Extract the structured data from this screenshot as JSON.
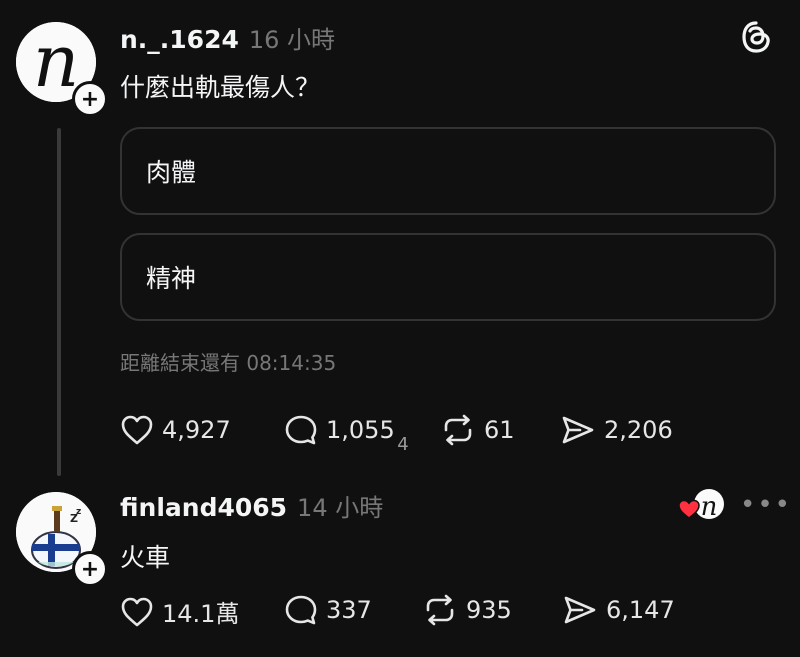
{
  "post": {
    "username": "n._.1624",
    "time": "16 小時",
    "text": "什麼出軌最傷人？",
    "poll": {
      "options": [
        {
          "label": "肉體"
        },
        {
          "label": "精神"
        }
      ],
      "remaining": "距離結束還有 08:14:35"
    },
    "actions": {
      "likes": "4,927",
      "comments": "1,05",
      "comments_digit_a": "5",
      "comments_digit_b": "4",
      "reposts": "61",
      "shares": "2,206"
    }
  },
  "reply": {
    "username": "finland4065",
    "time": "14 小時",
    "text": "火車",
    "actions": {
      "likes": "14.1萬",
      "comments": "337",
      "reposts": "935",
      "shares": "6,147"
    },
    "more_label": "•••"
  },
  "icons": {
    "app_logo": "threads-logo-icon",
    "like": "heart-icon",
    "comment": "comment-bubble-icon",
    "repost": "repost-icon",
    "share": "send-icon",
    "follow": "plus-icon",
    "liked_by_author": "red-heart-icon"
  },
  "colors": {
    "background": "#101010",
    "text": "#f3f5f7",
    "muted": "#777777",
    "border": "#333333",
    "heart_red": "#ff3040"
  }
}
